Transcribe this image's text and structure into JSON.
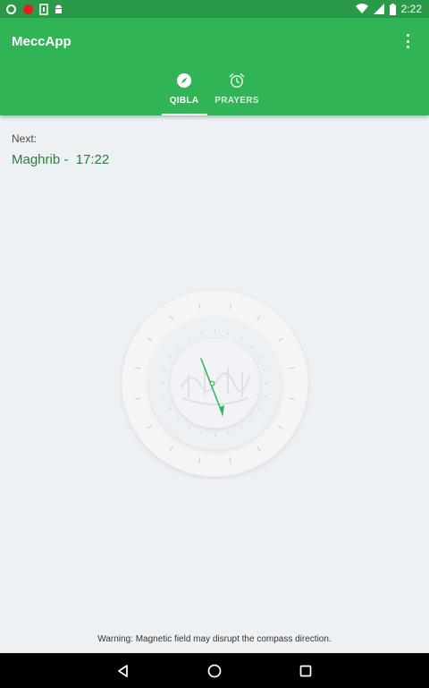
{
  "status_bar": {
    "time": "2:22",
    "icons": [
      "whatsapp-icon",
      "red-dot-icon",
      "sim-card-icon",
      "android-icon",
      "wifi-icon",
      "signal-icon",
      "battery-icon"
    ]
  },
  "app_bar": {
    "title": "MeccApp",
    "menu_icon": "more-vert-icon"
  },
  "tabs": [
    {
      "label": "QIBLA",
      "icon": "compass-icon",
      "selected": true
    },
    {
      "label": "PRAYERS",
      "icon": "alarm-icon",
      "selected": false
    }
  ],
  "next_prayer": {
    "label": "Next:",
    "value": "Maghrib -  17:22"
  },
  "compass": {
    "needle_icon": "crescent-icon",
    "needle_color": "#30b455"
  },
  "warning": "Warning: Magnetic field may disrupt the compass direction.",
  "nav_bar": {
    "back_icon": "back-triangle-icon",
    "home_icon": "home-circle-icon",
    "recents_icon": "recents-square-icon"
  },
  "colors": {
    "primary": "#30b455",
    "primary_dark": "#2a9a48",
    "accent_text": "#2a7d3d",
    "background": "#eef1f4"
  }
}
